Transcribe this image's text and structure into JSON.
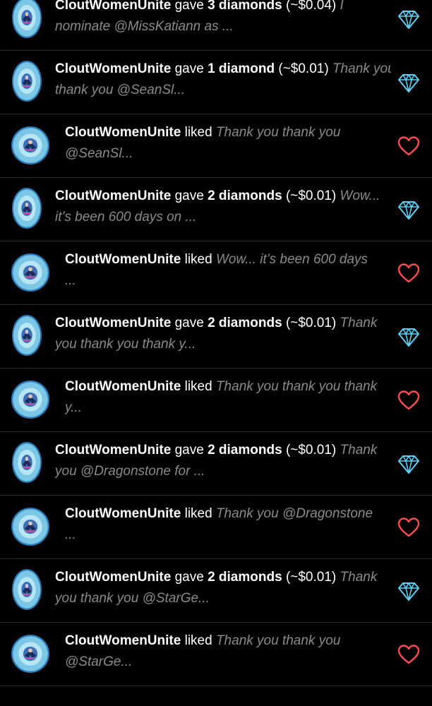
{
  "notifications": [
    {
      "type": "diamond",
      "user": "CloutWomenUnite",
      "verb": "gave",
      "amount": "3 diamonds",
      "usd": "(~$0.04)",
      "line1_snippet": "I",
      "line2": "nominate @MissKatiann as ...",
      "icon": "diamond-icon"
    },
    {
      "type": "diamond",
      "user": "CloutWomenUnite",
      "verb": "gave",
      "amount": "1 diamond",
      "usd": "(~$0.01)",
      "line1_snippet": "Thank you",
      "line2": "thank you @SeanSl...",
      "icon": "diamond-icon"
    },
    {
      "type": "like",
      "user": "CloutWomenUnite",
      "verb": "liked",
      "line1_snippet": "Thank you thank you",
      "line2": "@SeanSl...",
      "icon": "heart-icon"
    },
    {
      "type": "diamond",
      "user": "CloutWomenUnite",
      "verb": "gave",
      "amount": "2 diamonds",
      "usd": "(~$0.01)",
      "line1_snippet": "Wow...",
      "line2": "it’s been 600 days on ...",
      "icon": "diamond-icon"
    },
    {
      "type": "like",
      "user": "CloutWomenUnite",
      "verb": "liked",
      "line1_snippet": "Wow... it’s been 600 days",
      "line2": "...",
      "icon": "heart-icon"
    },
    {
      "type": "diamond",
      "user": "CloutWomenUnite",
      "verb": "gave",
      "amount": "2 diamonds",
      "usd": "(~$0.01)",
      "line1_snippet": "Thank",
      "line2": "you thank you thank y...",
      "icon": "diamond-icon"
    },
    {
      "type": "like",
      "user": "CloutWomenUnite",
      "verb": "liked",
      "line1_snippet": "Thank you thank you thank",
      "line2": "y...",
      "icon": "heart-icon"
    },
    {
      "type": "diamond",
      "user": "CloutWomenUnite",
      "verb": "gave",
      "amount": "2 diamonds",
      "usd": "(~$0.01)",
      "line1_snippet": "Thank",
      "line2": "you @Dragonstone for ...",
      "icon": "diamond-icon"
    },
    {
      "type": "like",
      "user": "CloutWomenUnite",
      "verb": "liked",
      "line1_snippet": "Thank you @Dragonstone",
      "line2": "...",
      "icon": "heart-icon"
    },
    {
      "type": "diamond",
      "user": "CloutWomenUnite",
      "verb": "gave",
      "amount": "2 diamonds",
      "usd": "(~$0.01)",
      "line1_snippet": "Thank",
      "line2": "you thank you @StarGe...",
      "icon": "diamond-icon"
    },
    {
      "type": "like",
      "user": "CloutWomenUnite",
      "verb": "liked",
      "line1_snippet": "Thank you thank you",
      "line2": "@StarGe...",
      "icon": "heart-icon"
    }
  ],
  "colors": {
    "background": "#000000",
    "diamond": "#5fd0f5",
    "heart": "#ff4d4d",
    "snippet": "#8a8a8a",
    "divider": "#2b2b2b"
  }
}
